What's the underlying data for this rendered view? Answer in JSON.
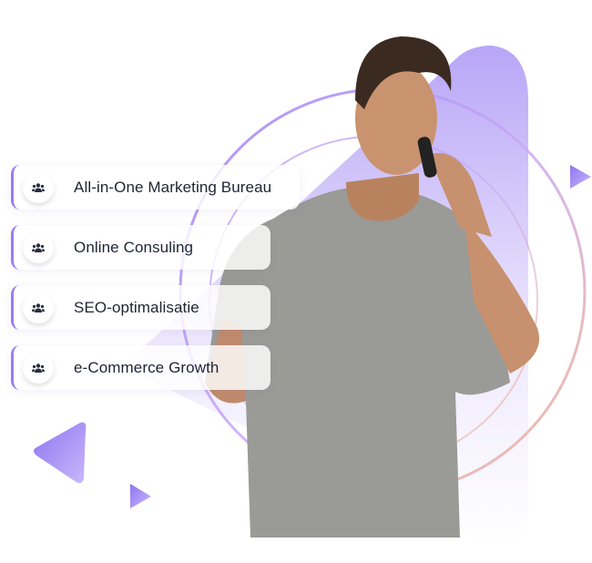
{
  "services": [
    {
      "label": "All-in-One Marketing Bureau",
      "icon": "users-icon"
    },
    {
      "label": "Online Consuling",
      "icon": "users-icon"
    },
    {
      "label": "SEO-optimalisatie",
      "icon": "users-icon"
    },
    {
      "label": "e-Commerce Growth",
      "icon": "users-icon"
    }
  ],
  "colors": {
    "accent": "#9a7cf5",
    "text": "#1f2433",
    "shirt": "#9a9a96"
  }
}
